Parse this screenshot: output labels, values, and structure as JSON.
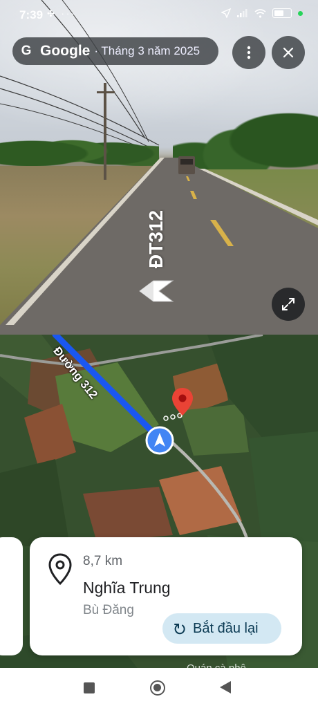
{
  "status_bar": {
    "time": "7:39",
    "left_icons": "✣ ···",
    "right_icons": [
      "location-arrow-icon",
      "signal-icon",
      "wifi-icon",
      "battery-icon"
    ],
    "battery_label": "",
    "dot_color": "#27d45a"
  },
  "header": {
    "brand": "Google",
    "date": "· Tháng 3 năm 2025",
    "more_button": "more-vert-icon",
    "close_button": "close-icon"
  },
  "streetview": {
    "road_label": "ĐT312"
  },
  "map": {
    "route_label": "Đường 312",
    "route_color": "#1a57f0",
    "pin_color": "#ea4335",
    "location_marker_color": "#4285f4"
  },
  "card": {
    "distance": "8,7 km",
    "place": "Nghĩa Trung",
    "region": "Bù Đăng",
    "restart_label": "Bắt đầu lại"
  },
  "peek_label": "Quán cà phê"
}
